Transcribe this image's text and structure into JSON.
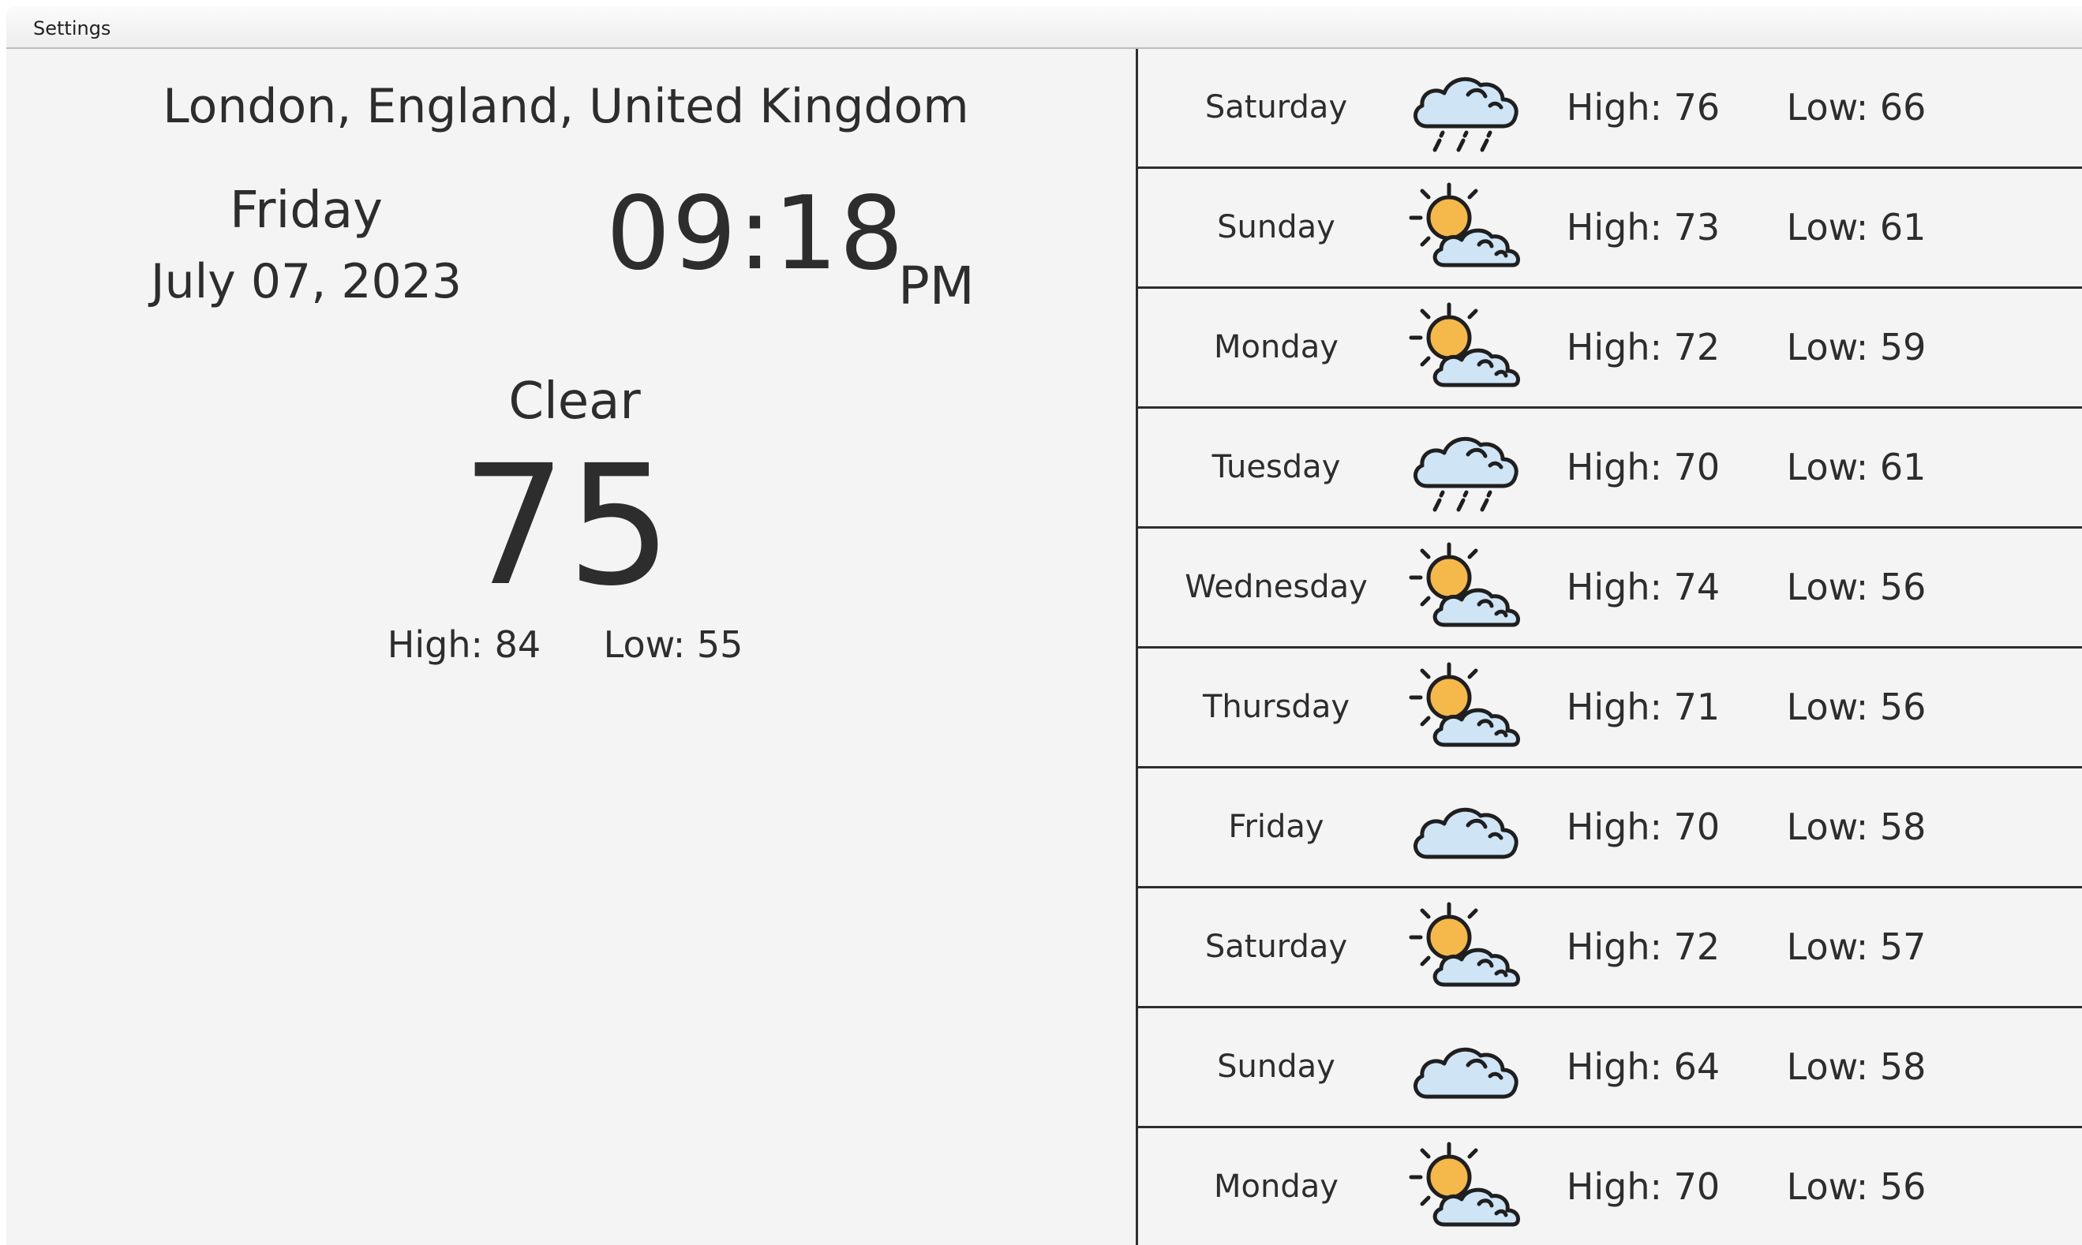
{
  "menu": {
    "settings_label": "Settings"
  },
  "current": {
    "location": "London, England, United Kingdom",
    "day": "Friday",
    "date": "July 07, 2023",
    "time": "09:18",
    "ampm": "PM",
    "condition": "Clear",
    "temperature": "75",
    "high": "High: 84",
    "low": "Low: 55"
  },
  "forecast": [
    {
      "day": "Saturday",
      "icon": "rain-cloud-icon",
      "high": "High: 76",
      "low": "Low: 66"
    },
    {
      "day": "Sunday",
      "icon": "partly-cloudy-icon",
      "high": "High: 73",
      "low": "Low: 61"
    },
    {
      "day": "Monday",
      "icon": "partly-cloudy-icon",
      "high": "High: 72",
      "low": "Low: 59"
    },
    {
      "day": "Tuesday",
      "icon": "rain-cloud-icon",
      "high": "High: 70",
      "low": "Low: 61"
    },
    {
      "day": "Wednesday",
      "icon": "partly-cloudy-icon",
      "high": "High: 74",
      "low": "Low: 56"
    },
    {
      "day": "Thursday",
      "icon": "partly-cloudy-icon",
      "high": "High: 71",
      "low": "Low: 56"
    },
    {
      "day": "Friday",
      "icon": "cloud-icon",
      "high": "High: 70",
      "low": "Low: 58"
    },
    {
      "day": "Saturday",
      "icon": "partly-cloudy-icon",
      "high": "High: 72",
      "low": "Low: 57"
    },
    {
      "day": "Sunday",
      "icon": "cloud-icon",
      "high": "High: 64",
      "low": "Low: 58"
    },
    {
      "day": "Monday",
      "icon": "partly-cloudy-icon",
      "high": "High: 70",
      "low": "Low: 56"
    }
  ],
  "colors": {
    "background": "#f4f4f4",
    "text": "#2d2d2d",
    "cloud_fill": "#cfe4f5",
    "sun_fill": "#f5b84a",
    "outline": "#1f1f1f"
  }
}
